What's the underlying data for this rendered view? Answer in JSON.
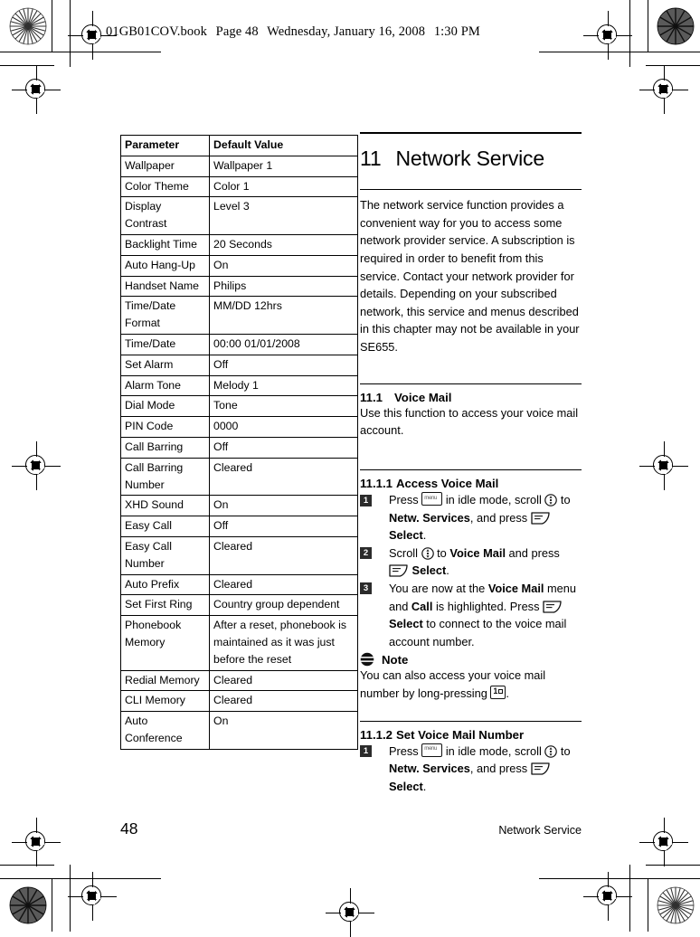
{
  "prepress": {
    "slug": {
      "filename": "01GB01COV.book",
      "page_label": "Page 48",
      "date": "Wednesday, January 16, 2008",
      "time": "1:30 PM"
    }
  },
  "table": {
    "headers": [
      "Parameter",
      "Default Value"
    ],
    "rows": [
      [
        "Wallpaper",
        "Wallpaper 1"
      ],
      [
        "Color Theme",
        "Color 1"
      ],
      [
        "Display Contrast",
        "Level 3"
      ],
      [
        "Backlight Time",
        "20 Seconds"
      ],
      [
        "Auto Hang-Up",
        "On"
      ],
      [
        "Handset Name",
        "Philips"
      ],
      [
        "Time/Date Format",
        "MM/DD 12hrs"
      ],
      [
        "Time/Date",
        "00:00 01/01/2008"
      ],
      [
        "Set Alarm",
        "Off"
      ],
      [
        "Alarm Tone",
        "Melody 1"
      ],
      [
        "Dial Mode",
        "Tone"
      ],
      [
        "PIN Code",
        "0000"
      ],
      [
        "Call Barring",
        "Off"
      ],
      [
        "Call Barring Number",
        "Cleared"
      ],
      [
        "XHD Sound",
        "On"
      ],
      [
        "Easy Call",
        "Off"
      ],
      [
        "Easy Call Number",
        "Cleared"
      ],
      [
        "Auto Prefix",
        "Cleared"
      ],
      [
        "Set First Ring",
        "Country group dependent"
      ],
      [
        "Phonebook Memory",
        "After a reset, phonebook is maintained as it was just before the reset"
      ],
      [
        "Redial Memory",
        "Cleared"
      ],
      [
        "CLI Memory",
        "Cleared"
      ],
      [
        "Auto Conference",
        "On"
      ]
    ]
  },
  "chapter": {
    "number": "11",
    "title": "Network Service",
    "intro": "The network service function provides a convenient way for you to access some network provider service. A subscription is required in order to benefit from this service. Contact your network provider for details. Depending on your subscribed network, this service and menus described in this chapter may not be available in your SE655."
  },
  "section_11_1": {
    "number": "11.1",
    "title": "Voice Mail",
    "body": "Use this function to access your voice mail account."
  },
  "section_11_1_1": {
    "number": "11.1.1",
    "title": "Access Voice Mail",
    "steps": [
      {
        "num": "1",
        "parts": [
          {
            "t": "text",
            "v": "Press "
          },
          {
            "t": "icon",
            "v": "menu-key-icon"
          },
          {
            "t": "text",
            "v": " in idle mode, scroll "
          },
          {
            "t": "icon",
            "v": "scroll-navigator-icon"
          },
          {
            "t": "text",
            "v": " to "
          },
          {
            "t": "bold",
            "v": "Netw. Services"
          },
          {
            "t": "text",
            "v": ", and press "
          },
          {
            "t": "icon",
            "v": "soft-key-icon"
          },
          {
            "t": "bold",
            "v": " Select"
          },
          {
            "t": "text",
            "v": "."
          }
        ]
      },
      {
        "num": "2",
        "parts": [
          {
            "t": "text",
            "v": "Scroll "
          },
          {
            "t": "icon",
            "v": "scroll-navigator-icon"
          },
          {
            "t": "text",
            "v": " to "
          },
          {
            "t": "bold",
            "v": "Voice Mail"
          },
          {
            "t": "text",
            "v": " and press "
          },
          {
            "t": "icon",
            "v": "soft-key-icon"
          },
          {
            "t": "bold",
            "v": " Select"
          },
          {
            "t": "text",
            "v": "."
          }
        ]
      },
      {
        "num": "3",
        "parts": [
          {
            "t": "text",
            "v": "You are now at the "
          },
          {
            "t": "bold",
            "v": "Voice Mail"
          },
          {
            "t": "text",
            "v": " menu and "
          },
          {
            "t": "bold",
            "v": "Call"
          },
          {
            "t": "text",
            "v": " is highlighted. Press "
          },
          {
            "t": "icon",
            "v": "soft-key-icon"
          },
          {
            "t": "bold",
            "v": " Select"
          },
          {
            "t": "text",
            "v": " to connect to the voice mail account number."
          }
        ]
      }
    ],
    "note": {
      "label": "Note",
      "parts": [
        {
          "t": "text",
          "v": "You can also access your voice mail number by long-pressing "
        },
        {
          "t": "icon",
          "v": "key-1-voicemail-icon"
        },
        {
          "t": "text",
          "v": "."
        }
      ]
    }
  },
  "section_11_1_2": {
    "number": "11.1.2",
    "title": "Set Voice Mail Number",
    "steps": [
      {
        "num": "1",
        "parts": [
          {
            "t": "text",
            "v": "Press "
          },
          {
            "t": "icon",
            "v": "menu-key-icon"
          },
          {
            "t": "text",
            "v": " in idle mode, scroll "
          },
          {
            "t": "icon",
            "v": "scroll-navigator-icon"
          },
          {
            "t": "text",
            "v": " to "
          },
          {
            "t": "bold",
            "v": "Netw. Services"
          },
          {
            "t": "text",
            "v": ", and press "
          },
          {
            "t": "icon",
            "v": "soft-key-icon"
          },
          {
            "t": "bold",
            "v": " Select"
          },
          {
            "t": "text",
            "v": "."
          }
        ]
      }
    ]
  },
  "footer": {
    "page_number": "48",
    "running_title": "Network Service"
  },
  "colors": {
    "ink": "#000000",
    "paper": "#ffffff",
    "step_badge": "#2b2b2b"
  }
}
